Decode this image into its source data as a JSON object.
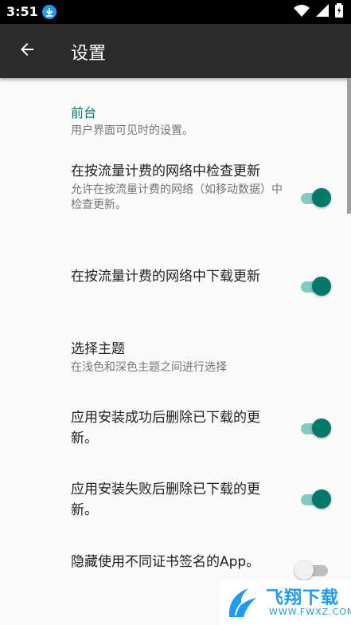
{
  "status_bar": {
    "time": "3:51",
    "icons": [
      "download-icon",
      "wifi-icon",
      "signal-icon",
      "battery-charging-icon"
    ]
  },
  "app_bar": {
    "title": "设置",
    "back_icon": "arrow-back-icon"
  },
  "category": {
    "title": "前台",
    "summary": "用户界面可见时的设置。"
  },
  "preferences": [
    {
      "title": "在按流量计费的网络中检查更新",
      "summary": "允许在按流量计费的网络（如移动数据）中检查更新。",
      "switch_on": true
    },
    {
      "title": "在按流量计费的网络中下载更新",
      "summary": "",
      "switch_on": true
    },
    {
      "title": "选择主题",
      "summary": "在浅色和深色主题之间进行选择"
    },
    {
      "title": "应用安装成功后删除已下载的更新。",
      "summary": "",
      "switch_on": true
    },
    {
      "title": "应用安装失败后删除已下载的更新。",
      "summary": "",
      "switch_on": true
    },
    {
      "title": "隐藏使用不同证书签名的App。",
      "summary": "",
      "switch_on": false
    }
  ],
  "watermark": {
    "text": "飞翔下载",
    "url": "WWW.FWXZ.COM"
  },
  "colors": {
    "accent": "#00796b",
    "accent_track": "#80cbc4",
    "app_bar": "#2b2b2b",
    "background": "#fafafa"
  }
}
